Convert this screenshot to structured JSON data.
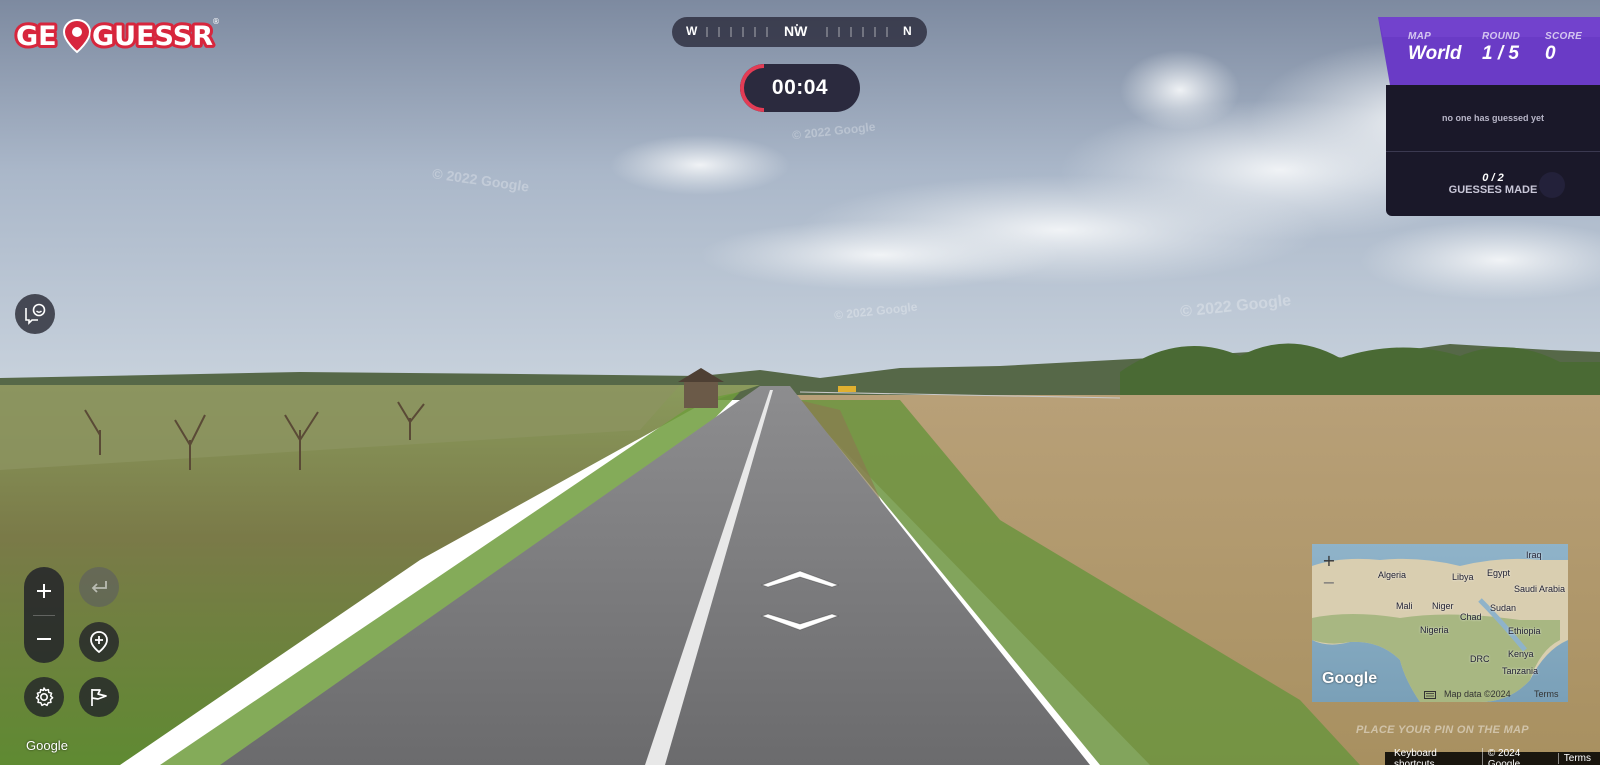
{
  "logo": {
    "text_left": "GE",
    "text_right": "GUESSR",
    "mark": "®",
    "brand_color": "#d7263d"
  },
  "compass": {
    "heading_label": "NW",
    "left_label": "W",
    "right_label": "N"
  },
  "timer": {
    "value": "00:04",
    "progress_fraction": 0.1,
    "accent_color": "#e33c55"
  },
  "status": {
    "map_label": "MAP",
    "map_value": "World",
    "round_label": "ROUND",
    "round_value": "1 / 5",
    "score_label": "SCORE",
    "score_value": "0",
    "message": "no one has guessed yet",
    "guesses_count": "0 / 2",
    "guesses_label": "GUESSES MADE",
    "header_color": "#6a3bc6"
  },
  "watermarks": [
    "© 2022 Google",
    "© 2022 Google",
    "© 2022 Google",
    "© 2022 Google"
  ],
  "controls": {
    "chat_icon": "chat-smile-icon",
    "zoom_in_icon": "plus-icon",
    "zoom_out_icon": "minus-icon",
    "undo_icon": "return-arrow-icon",
    "pin_icon": "map-pin-plus-icon",
    "settings_icon": "gear-icon",
    "flag_icon": "flag-icon"
  },
  "minimap": {
    "places": [
      "Algeria",
      "Libya",
      "Egypt",
      "Iraq",
      "Saudi Arabia",
      "Mali",
      "Niger",
      "Chad",
      "Sudan",
      "Nigeria",
      "Ethiopia",
      "Kenya",
      "DRC",
      "Tanzania"
    ],
    "zoom_in": "+",
    "zoom_out": "−",
    "google": "Google",
    "map_data": "Map data ©2024",
    "terms": "Terms"
  },
  "pin_hint": "PLACE YOUR PIN ON THE MAP",
  "google_logo": "Google",
  "footer": {
    "shortcuts": "Keyboard shortcuts",
    "copyright": "© 2024 Google",
    "terms": "Terms"
  }
}
